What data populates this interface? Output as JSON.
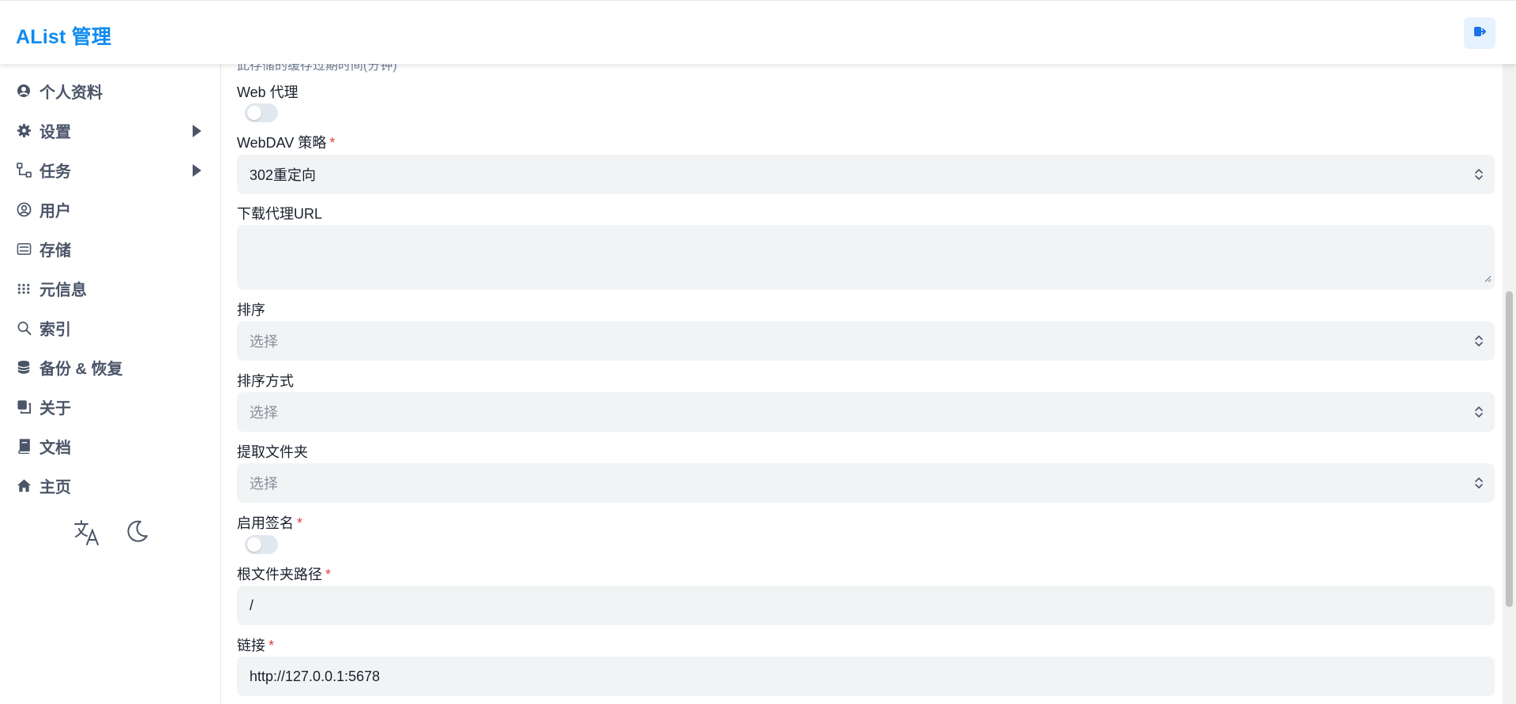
{
  "header": {
    "title": "AList 管理"
  },
  "sidebar": {
    "items": [
      {
        "label": "个人资料",
        "icon": "avatar-icon"
      },
      {
        "label": "设置",
        "icon": "gear-icon",
        "expandable": true
      },
      {
        "label": "任务",
        "icon": "workflow-icon",
        "expandable": true
      },
      {
        "label": "用户",
        "icon": "user-circle-icon"
      },
      {
        "label": "存储",
        "icon": "storage-icon"
      },
      {
        "label": "元信息",
        "icon": "metadata-icon"
      },
      {
        "label": "索引",
        "icon": "search-icon"
      },
      {
        "label": "备份 & 恢复",
        "icon": "database-icon"
      },
      {
        "label": "关于",
        "icon": "copy-icon"
      },
      {
        "label": "文档",
        "icon": "book-icon"
      },
      {
        "label": "主页",
        "icon": "home-icon"
      }
    ],
    "tools": [
      "translate-icon",
      "moon-icon"
    ]
  },
  "form": {
    "cache_hint": "此存储的缓存过期时间(分钟)",
    "web_proxy": {
      "label": "Web 代理",
      "enabled": false
    },
    "webdav_policy": {
      "label": "WebDAV 策略",
      "required": "*",
      "value": "302重定向"
    },
    "download_proxy_url": {
      "label": "下载代理URL",
      "value": ""
    },
    "order_by": {
      "label": "排序",
      "placeholder": "选择"
    },
    "order_direction": {
      "label": "排序方式",
      "placeholder": "选择"
    },
    "extract_folder": {
      "label": "提取文件夹",
      "placeholder": "选择"
    },
    "enable_sign": {
      "label": "启用签名",
      "required": "*",
      "enabled": false
    },
    "root_folder_path": {
      "label": "根文件夹路径",
      "required": "*",
      "value": "/"
    },
    "link": {
      "label": "链接",
      "required": "*",
      "value": "http://127.0.0.1:5678"
    }
  },
  "colors": {
    "brand": "#0f8bf0",
    "required": "#e53e3e",
    "field_bg": "#f1f3f5"
  }
}
